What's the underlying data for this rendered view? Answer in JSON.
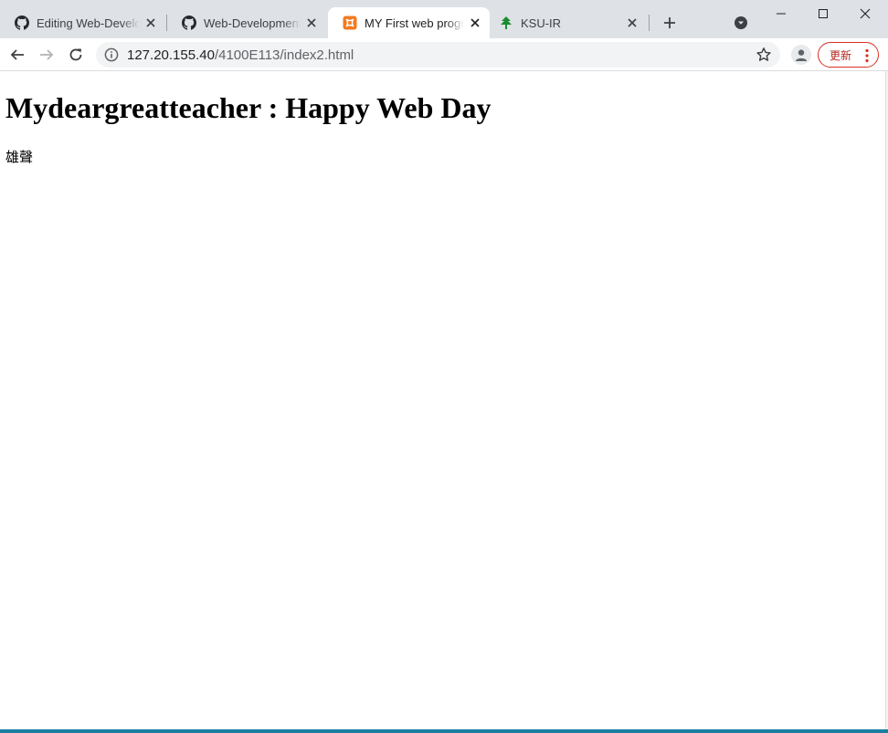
{
  "tabs": [
    {
      "title": "Editing Web-Development/README.md",
      "favicon": "github-icon",
      "active": false
    },
    {
      "title": "Web-Development/README.md",
      "favicon": "github-icon",
      "active": false
    },
    {
      "title": "MY First web program",
      "favicon": "xampp-icon",
      "active": true
    },
    {
      "title": "KSU-IR",
      "favicon": "ksu-tree-icon",
      "active": false
    }
  ],
  "address_bar": {
    "host": "127.20.155.40",
    "path": "/4100E113/index2.html"
  },
  "update_button": {
    "label": "更新"
  },
  "page": {
    "heading": "Mydeargreatteacher : Happy Web Day",
    "text": "雄聲"
  },
  "colors": {
    "tabstrip": "#dee1e6",
    "accent_update": "#d93025",
    "xampp_orange": "#f47a20",
    "ksu_green": "#1a8c2e"
  }
}
